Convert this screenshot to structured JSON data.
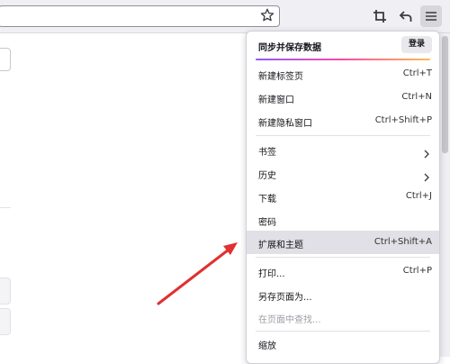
{
  "toolbar": {
    "url_placeholder": "",
    "icons": [
      "star-icon",
      "screenshot-crop-icon",
      "back-icon",
      "hamburger-menu-icon"
    ]
  },
  "menu": {
    "header_title": "同步并保存数据",
    "signin_label": "登录",
    "items": [
      {
        "label": "新建标签页",
        "shortcut": "Ctrl+T"
      },
      {
        "label": "新建窗口",
        "shortcut": "Ctrl+N"
      },
      {
        "label": "新建隐私窗口",
        "shortcut": "Ctrl+Shift+P"
      },
      {
        "label": "书签",
        "shortcut": ""
      },
      {
        "label": "历史",
        "shortcut": ""
      },
      {
        "label": "下载",
        "shortcut": "Ctrl+J"
      },
      {
        "label": "密码",
        "shortcut": ""
      },
      {
        "label": "扩展和主题",
        "shortcut": "Ctrl+Shift+A"
      },
      {
        "label": "打印...",
        "shortcut": "Ctrl+P"
      },
      {
        "label": "另存页面为...",
        "shortcut": ""
      },
      {
        "label": "在页面中查找...",
        "shortcut": ""
      },
      {
        "label": "缩放",
        "shortcut": ""
      }
    ]
  },
  "colors": {
    "toolbar_bg": "#f0f0f4",
    "highlight_bg": "#e0e0e6",
    "arrow": "#e03030",
    "disabled_text": "#9e9ea6"
  }
}
